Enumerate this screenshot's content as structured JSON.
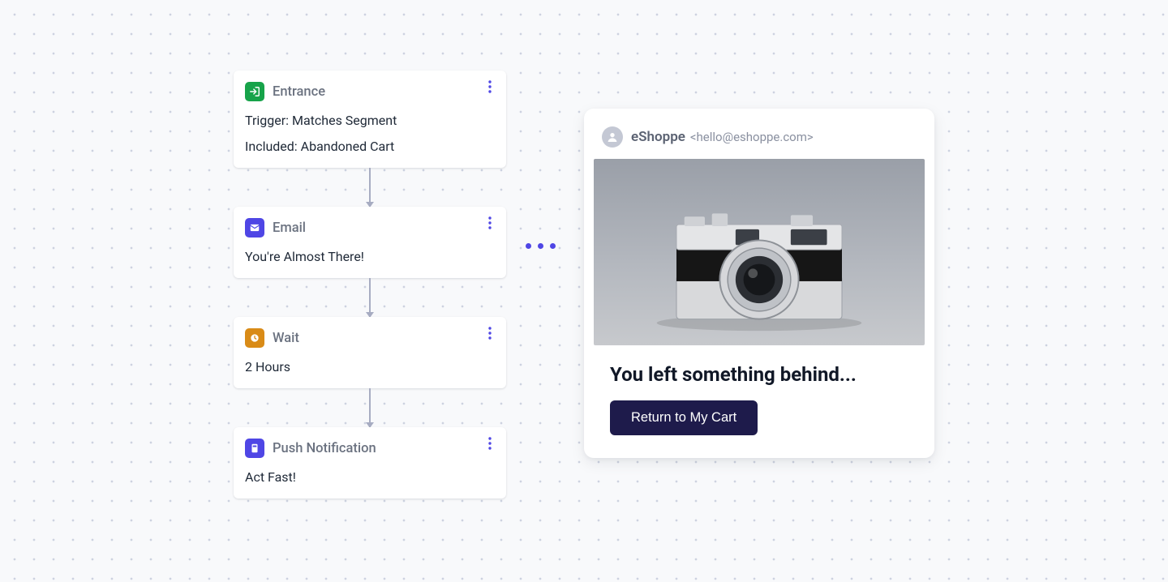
{
  "flow": {
    "nodes": [
      {
        "icon": "entrance",
        "iconColor": "green",
        "title": "Entrance",
        "lines": [
          "Trigger: Matches Segment",
          "Included: Abandoned Cart"
        ]
      },
      {
        "icon": "email",
        "iconColor": "indigo",
        "title": "Email",
        "lines": [
          "You're Almost There!"
        ]
      },
      {
        "icon": "wait",
        "iconColor": "amber",
        "title": "Wait",
        "lines": [
          "2 Hours"
        ]
      },
      {
        "icon": "push",
        "iconColor": "indigo",
        "title": "Push Notification",
        "lines": [
          "Act Fast!"
        ]
      }
    ]
  },
  "preview": {
    "sender_name": "eShoppe",
    "sender_email": "<hello@eshoppe.com>",
    "headline": "You left something behind...",
    "cta_label": "Return to My Cart",
    "hero_alt": "camera-product-image"
  }
}
